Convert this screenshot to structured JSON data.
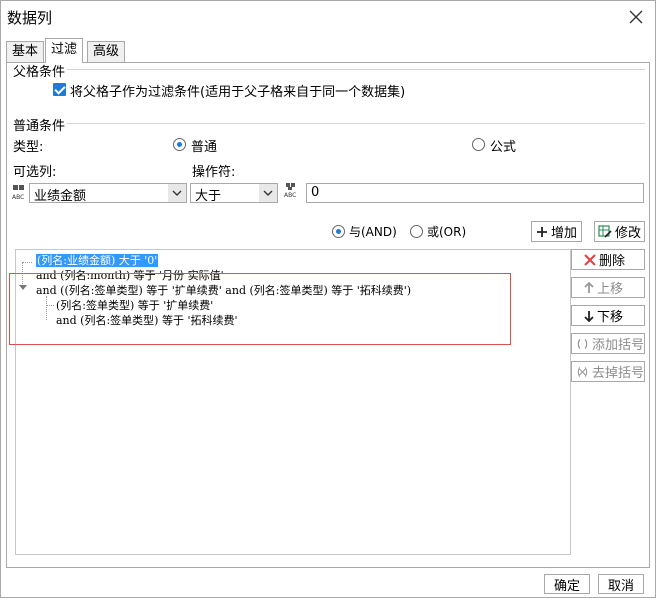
{
  "window": {
    "title": "数据列"
  },
  "tabs": [
    {
      "label": "基本"
    },
    {
      "label": "过滤"
    },
    {
      "label": "高级"
    }
  ],
  "parent_conditions": {
    "group_label": "父格条件",
    "checkbox_label": "将父格子作为过滤条件(适用于父子格来自于同一个数据集)",
    "checked": true
  },
  "normal_conditions": {
    "group_label": "普通条件",
    "type_label": "类型:",
    "type_options": [
      {
        "label": "普通",
        "checked": true
      },
      {
        "label": "公式",
        "checked": false
      }
    ],
    "column_label": "可选列:",
    "operator_label": "操作符:",
    "column_value": "业绩金额",
    "operator_value": "大于",
    "value_text": "0"
  },
  "logic": {
    "and_label": "与(AND)",
    "or_label": "或(OR)",
    "and_checked": true,
    "add_button": "增加",
    "modify_button": "修改"
  },
  "tree": {
    "rows": [
      "(列名:业绩金额) 大于 '0'",
      "and (列名:month) 等于 '月份 实际值'",
      "and ((列名:签单类型) 等于 '扩单续费' and (列名:签单类型) 等于 '拓科续费')",
      "(列名:签单类型) 等于 '扩单续费'",
      "and (列名:签单类型) 等于 '拓科续费'"
    ]
  },
  "side_buttons": {
    "delete": "删除",
    "move_up": "上移",
    "move_down": "下移",
    "add_bracket": "添加括号",
    "remove_bracket": "去掉括号"
  },
  "footer": {
    "ok": "确定",
    "cancel": "取消"
  },
  "colors": {
    "accent": "#1e7ad7",
    "selection": "#3399ff",
    "highlight_border": "#d9534f",
    "delete_icon": "#e04040"
  }
}
